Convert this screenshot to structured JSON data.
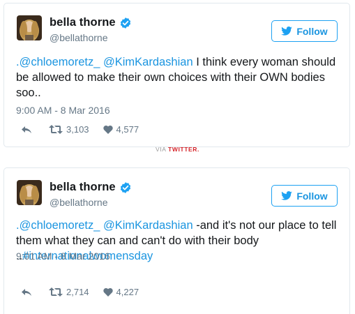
{
  "tweets": [
    {
      "display_name": "bella thorne",
      "handle": "@bellathorne",
      "follow_label": "Follow",
      "text_parts": {
        "mention1": ".@chloemoretz_",
        "mention2": "@KimKardashian",
        "body": " I think every woman should be allowed to make their own choices with their OWN bodies soo.."
      },
      "timestamp": "9:00 AM - 8 Mar 2016",
      "retweets": "3,103",
      "likes": "4,577"
    },
    {
      "display_name": "bella thorne",
      "handle": "@bellathorne",
      "follow_label": "Follow",
      "text_parts": {
        "mention1": ".@chloemoretz_",
        "mention2": "@KimKardashian",
        "body": " -and it's not our place to tell them what they can and can't do with their body\n..",
        "hashtag": "#internationalwomensday"
      },
      "timestamp": "9:01 AM - 8 Mar 2016",
      "retweets": "2,714",
      "likes": "4,227"
    }
  ],
  "via": {
    "prefix": "VIA",
    "source": "TWITTER",
    "suffix": "."
  },
  "icons": {
    "verified": "verified-badge-icon",
    "follow": "twitter-bird-icon",
    "reply": "reply-icon",
    "retweet": "retweet-icon",
    "like": "heart-icon"
  },
  "colors": {
    "accent": "#1b95e0",
    "verified": "#1da1f2",
    "muted": "#657786",
    "via_source": "#d6242a"
  }
}
